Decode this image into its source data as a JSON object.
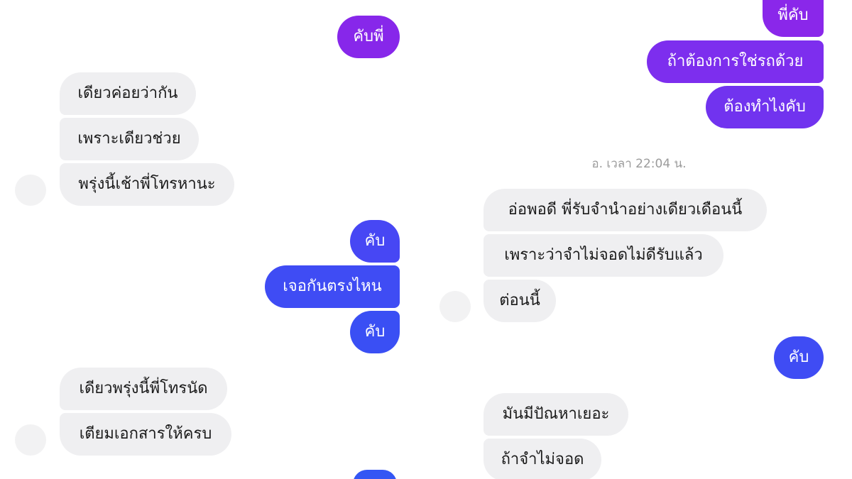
{
  "colors": {
    "incoming_bubble": "#efeff1",
    "incoming_text": "#1b1b1b",
    "outgoing_text": "#ffffff",
    "outgoing_purple": "#7b2ef0",
    "outgoing_blue": "#3f4cf4",
    "timestamp": "#9b9b9b"
  },
  "left_chat": {
    "messages": [
      {
        "text": "คับพี่",
        "from": "me"
      },
      {
        "text": "เดียวค่อยว่ากัน",
        "from": "other"
      },
      {
        "text": "เพราะเดียวช่วย",
        "from": "other"
      },
      {
        "text": "พรุ่งนี้เช้าพี่โทรหานะ",
        "from": "other"
      },
      {
        "text": "คับ",
        "from": "me"
      },
      {
        "text": "เจอกันตรงไหน",
        "from": "me"
      },
      {
        "text": "คับ",
        "from": "me"
      },
      {
        "text": "เดียวพรุ่งนี้พี่โทรนัด",
        "from": "other"
      },
      {
        "text": "เตียมเอกสารให้ครบ",
        "from": "other"
      }
    ]
  },
  "right_chat": {
    "messages": [
      {
        "text": "พี่คับ",
        "from": "me"
      },
      {
        "text": "ถ้าต้องการใช่รถด้วย",
        "from": "me"
      },
      {
        "text": "ต้องทำไงคับ",
        "from": "me"
      },
      {
        "text": "อ่อพอดี พี่รับจำนำอย่างเดียวเดือนนี้",
        "from": "other"
      },
      {
        "text": "เพราะว่าจำไม่จอดไม่ดีรับแล้ว",
        "from": "other"
      },
      {
        "text": "ต่อนนี้",
        "from": "other"
      },
      {
        "text": "คับ",
        "from": "me"
      },
      {
        "text": "มันมีปัณหาเยอะ",
        "from": "other"
      },
      {
        "text": "ถ้าจำไม่จอด",
        "from": "other"
      }
    ],
    "timestamp": "อ. เวลา 22:04 น."
  }
}
